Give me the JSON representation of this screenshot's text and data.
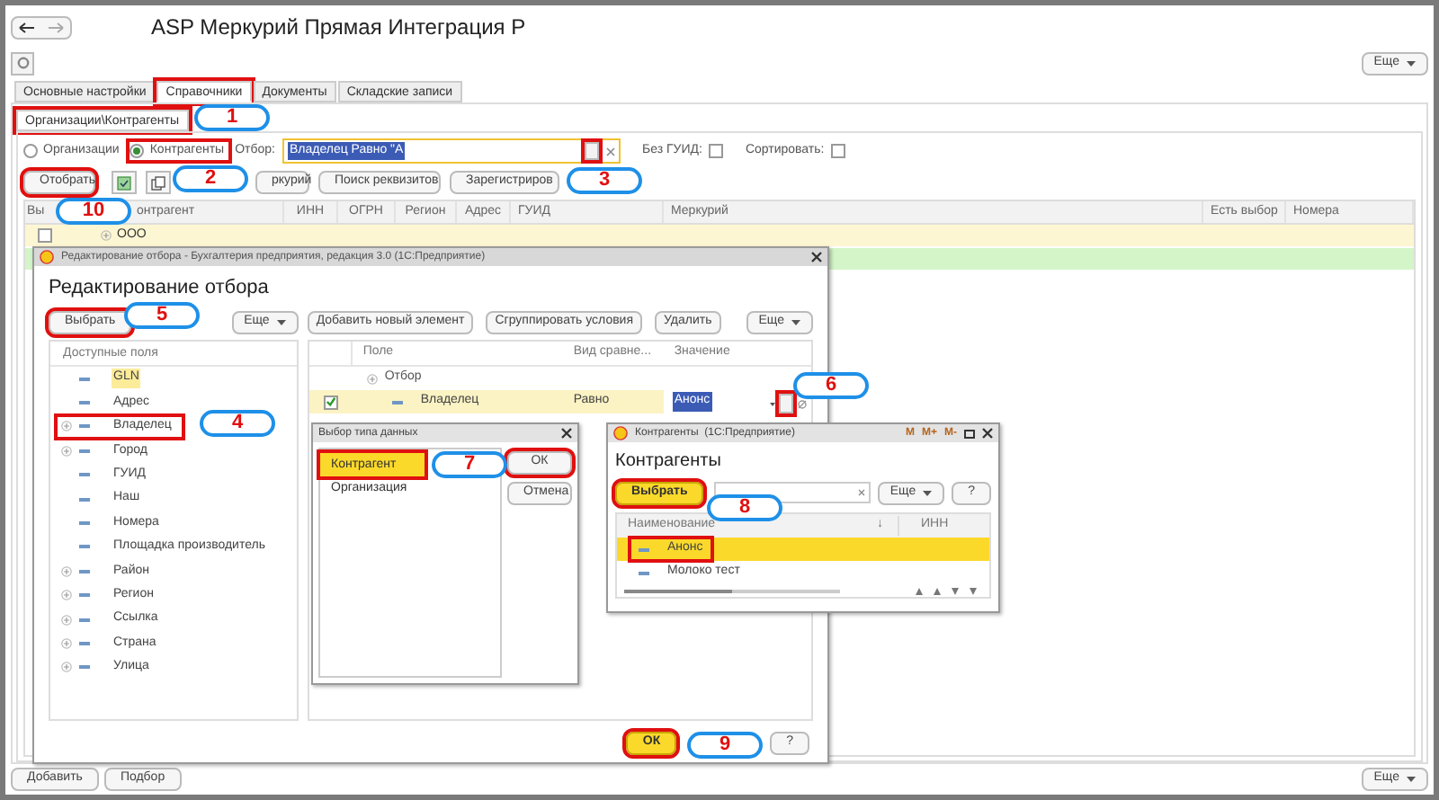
{
  "window": {
    "title": "ASP Меркурий Прямая Интеграция Р",
    "more_top": "Еще",
    "more_bottom": "Еще"
  },
  "tabs": [
    {
      "label": "Основные настройки",
      "selected": false,
      "marked": false
    },
    {
      "label": "Справочники",
      "selected": true,
      "marked": true
    },
    {
      "label": "Документы",
      "selected": false,
      "marked": false
    },
    {
      "label": "Складские записи",
      "selected": false,
      "marked": false
    }
  ],
  "subtabs": [
    {
      "label": "Организации\\Контрагенты",
      "selected": true,
      "marked": true
    }
  ],
  "mode_radios": [
    {
      "label": "Организации",
      "selected": false,
      "marked": false
    },
    {
      "label": "Контрагенты",
      "selected": true,
      "marked": true
    }
  ],
  "filter": {
    "label": "Отбор:",
    "value": "Владелец Равно \"А",
    "pick_marked": true
  },
  "options": [
    {
      "label": "Без ГУИД:",
      "checked": false
    },
    {
      "label": "Сортировать:",
      "checked": false
    }
  ],
  "toolbar": [
    {
      "label": "Отобрать",
      "marked": true
    },
    {
      "label": "ркурий",
      "marked": false
    },
    {
      "label": "Поиск реквизитов",
      "marked": false
    },
    {
      "label": "Зарегистриров",
      "marked": false
    }
  ],
  "table": {
    "columns": [
      "Вы",
      "онтрагент",
      "ИНН",
      "ОГРН",
      "Регион",
      "Адрес",
      "ГУИД",
      "Меркурий",
      "Есть выбор",
      "Номера"
    ],
    "rows": [
      {
        "name": "ООО",
        "checked": false,
        "color": "#fdf6d2"
      },
      {
        "name": "",
        "color": "#d3f5c8"
      }
    ]
  },
  "bottom_buttons": [
    "Добавить",
    "Подбор"
  ],
  "filter_dialog": {
    "title": "Редактирование отбора - Бухгалтерия предприятия, редакция 3.0 (1С:Предприятие)",
    "heading": "Редактирование отбора",
    "left_buttons": [
      {
        "label": "Выбрать",
        "marked": true
      }
    ],
    "more_left": "Еще",
    "more_right": "Еще",
    "fields_header": "Доступные поля",
    "fields": [
      {
        "label": "GLN",
        "expandable": false,
        "highlighted": true,
        "marked": false
      },
      {
        "label": "Адрес",
        "expandable": false,
        "highlighted": false,
        "marked": false
      },
      {
        "label": "Владелец",
        "expandable": true,
        "highlighted": false,
        "marked": true
      },
      {
        "label": "Город",
        "expandable": true,
        "highlighted": false,
        "marked": false
      },
      {
        "label": "ГУИД",
        "expandable": false,
        "highlighted": false,
        "marked": false
      },
      {
        "label": "Наш",
        "expandable": false,
        "highlighted": false,
        "marked": false
      },
      {
        "label": "Номера",
        "expandable": false,
        "highlighted": false,
        "marked": false
      },
      {
        "label": "Площадка производитель",
        "expandable": false,
        "highlighted": false,
        "marked": false
      },
      {
        "label": "Район",
        "expandable": true,
        "highlighted": false,
        "marked": false
      },
      {
        "label": "Регион",
        "expandable": true,
        "highlighted": false,
        "marked": false
      },
      {
        "label": "Ссылка",
        "expandable": true,
        "highlighted": false,
        "marked": false
      },
      {
        "label": "Страна",
        "expandable": true,
        "highlighted": false,
        "marked": false
      },
      {
        "label": "Улица",
        "expandable": true,
        "highlighted": false,
        "marked": false
      }
    ],
    "right_buttons": [
      "Добавить новый элемент",
      "Сгруппировать условия",
      "Удалить"
    ],
    "columns": [
      "Поле",
      "Вид сравне...",
      "Значение"
    ],
    "group": "Отбор",
    "condition": {
      "checked": true,
      "field": "Владелец",
      "comparison": "Равно",
      "value": "Анонс",
      "pick_marked": true
    },
    "ok": {
      "label": "ОК",
      "marked": true
    },
    "help": "?"
  },
  "type_dialog": {
    "title": "Выбор типа данных",
    "items": [
      {
        "label": "Контрагент",
        "selected": true,
        "marked": true
      },
      {
        "label": "Организация",
        "selected": false,
        "marked": false
      }
    ],
    "buttons": [
      {
        "label": "ОК",
        "marked": true
      },
      {
        "label": "Отмена",
        "marked": false
      }
    ]
  },
  "contractors_dialog": {
    "title": "Контрагенты  (1С:Предприятие)",
    "title_buttons": [
      "M",
      "M+",
      "M-"
    ],
    "heading": "Контрагенты",
    "select": {
      "label": "Выбрать",
      "marked": true
    },
    "more": "Еще",
    "help": "?",
    "columns": [
      "Наименование",
      "ИНН"
    ],
    "sort_mark": "↓",
    "rows": [
      {
        "name": "Анонс",
        "selected": true,
        "marked": true
      },
      {
        "name": "Молоко тест",
        "selected": false,
        "marked": false
      }
    ]
  },
  "callouts": [
    "1",
    "2",
    "3",
    "4",
    "5",
    "6",
    "7",
    "8",
    "9",
    "10"
  ]
}
